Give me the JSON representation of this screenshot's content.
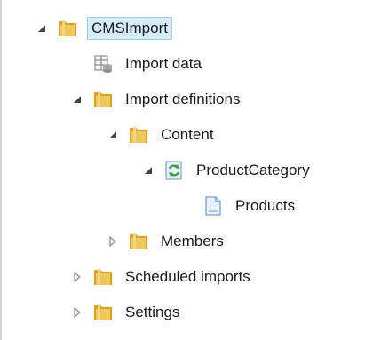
{
  "tree": {
    "root": {
      "label": "CMSImport",
      "icon": "folder-icon",
      "expanded": true,
      "selected": true
    },
    "import_data": {
      "label": "Import data",
      "icon": "database-icon"
    },
    "import_definitions": {
      "label": "Import definitions",
      "icon": "folder-icon",
      "expanded": true
    },
    "content": {
      "label": "Content",
      "icon": "folder-icon",
      "expanded": true
    },
    "product_category": {
      "label": "ProductCategory",
      "icon": "sync-document-icon",
      "expanded": true
    },
    "products": {
      "label": "Products",
      "icon": "document-icon"
    },
    "members": {
      "label": "Members",
      "icon": "folder-icon",
      "expanded": false
    },
    "scheduled_imports": {
      "label": "Scheduled imports",
      "icon": "folder-icon",
      "expanded": false
    },
    "settings": {
      "label": "Settings",
      "icon": "folder-icon",
      "expanded": false
    }
  },
  "colors": {
    "selection_bg": "#d6ecfb",
    "selection_border": "#9fcbed",
    "folder": "#e8b94a"
  }
}
